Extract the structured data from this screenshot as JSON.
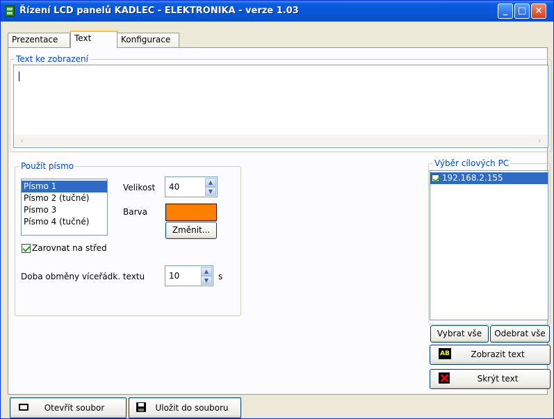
{
  "window": {
    "title": "Řízení LCD panelů KADLEC - ELEKTRONIKA  - verze 1.03",
    "minimize": "_",
    "maximize": "□",
    "close": "×"
  },
  "tabs": [
    {
      "label": "Prezentace",
      "active": false
    },
    {
      "label": "Text",
      "active": true
    },
    {
      "label": "Konfigurace",
      "active": false
    }
  ],
  "text_group": {
    "legend": "Text ke zobrazení",
    "value": "",
    "scroll_left": "‹",
    "scroll_right": "›"
  },
  "font_group": {
    "legend": "Použít písmo",
    "fonts": [
      "Písmo 1",
      "Písmo 2 (tučné)",
      "Písmo 3",
      "Písmo 4 (tučné)"
    ],
    "selected_font_index": 0,
    "size_label": "Velikost",
    "size_value": "40",
    "color_label": "Barva",
    "color_value": "#ff8000",
    "change_button": "Změnit...",
    "center_checkbox": "Zarovnat na střed",
    "center_checked": true,
    "interval_label": "Doba obměny víceřádk. textu",
    "interval_value": "10",
    "interval_unit": "s",
    "spin_up": "▲",
    "spin_down": "▼"
  },
  "targets_group": {
    "legend": "Výběr cílových PC",
    "items": [
      {
        "label": "192.168.2.155",
        "checked": true
      }
    ],
    "select_all": "Vybrat vše",
    "deselect_all": "Odebrat vše",
    "show_text": "Zobrazit text",
    "show_icon_text": "AB",
    "hide_text": "Skrýt text"
  },
  "bottom_bar": {
    "open_file": "Otevřít soubor",
    "save_file": "Uložit do souboru"
  },
  "colors": {
    "titlebar": "#0857d6",
    "accent_tab": "#ffc83c",
    "selection": "#316ac5",
    "legend_text": "#0046d5"
  }
}
